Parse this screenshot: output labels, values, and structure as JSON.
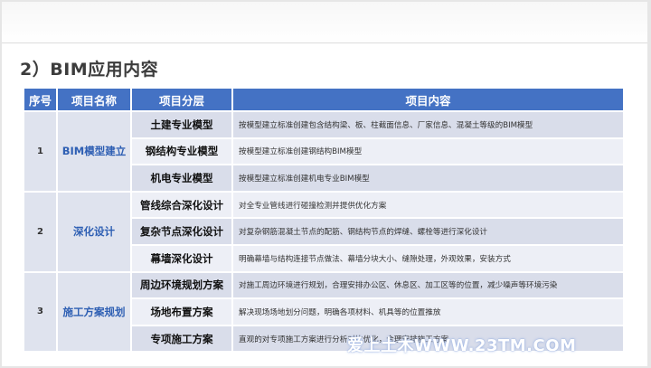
{
  "section_title": "2）BIM应用内容",
  "table": {
    "headers": [
      "序号",
      "项目名称",
      "项目分层",
      "项目内容"
    ],
    "groups": [
      {
        "no": "1",
        "name": "BIM模型建立",
        "rows": [
          {
            "category": "土建专业模型",
            "content": "按模型建立标准创建包含结构梁、板、柱截面信息、厂家信息、混凝土等级的BIM模型"
          },
          {
            "category": "钢结构专业模型",
            "content": "按模型建立标准创建钢结构BIM模型"
          },
          {
            "category": "机电专业模型",
            "content": "按模型建立标准创建机电专业BIM模型"
          }
        ]
      },
      {
        "no": "2",
        "name": "深化设计",
        "rows": [
          {
            "category": "管线综合深化设计",
            "content": "对全专业管线进行碰撞检测并提供优化方案"
          },
          {
            "category": "复杂节点深化设计",
            "content": "对复杂钢筋混凝土节点的配筋、钢结构节点的焊缝、螺栓等进行深化设计"
          },
          {
            "category": "幕墙深化设计",
            "content": "明确幕墙与结构连接节点做法、幕墙分块大小、缝隙处理，外观效果，安装方式"
          }
        ]
      },
      {
        "no": "3",
        "name": "施工方案规划",
        "rows": [
          {
            "category": "周边环境规划方案",
            "content": "对施工周边环境进行规划，合理安排办公区、休息区、加工区等的位置，减少噪声等环境污染"
          },
          {
            "category": "场地布置方案",
            "content": "解决现场场地划分问题，明确各项材料、机具等的位置推放"
          },
          {
            "category": "专项施工方案",
            "content": "直观的对专项施工方案进行分析对比优化，合理安排施工方案"
          }
        ]
      }
    ]
  },
  "watermark": "爱上土木WWW.23TM.COM",
  "colors": {
    "header_bg": "#4472c4",
    "group_name": "#2e5fb3",
    "row_shade": "#d9ddea",
    "row_light": "#edeff6"
  }
}
